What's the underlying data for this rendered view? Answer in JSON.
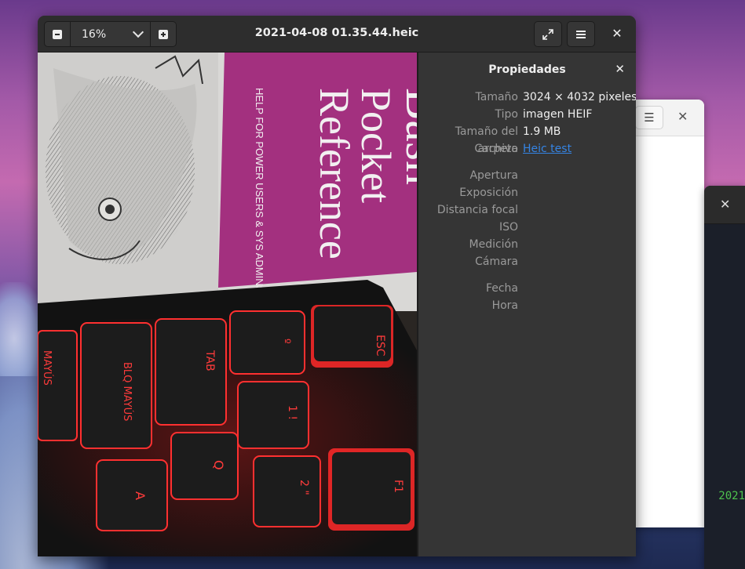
{
  "window": {
    "title": "2021-04-08 01.35.44.heic",
    "zoom": "16%"
  },
  "icons": {
    "zoom_out": "minus-square-icon",
    "zoom_in": "plus-square-icon",
    "zoom_dropdown": "chevron-down-icon",
    "fullscreen": "fullscreen-icon",
    "menu": "hamburger-menu-icon",
    "close": "close-icon"
  },
  "properties": {
    "title": "Propiedades",
    "rows": [
      {
        "key": "Tamaño",
        "value": "3024 × 4032 pixeles"
      },
      {
        "key": "Tipo",
        "value": "imagen HEIF"
      },
      {
        "key": "Tamaño del archivo",
        "value": "1.9 MB"
      },
      {
        "key": "Carpeta",
        "value": "Heic test"
      }
    ],
    "exif": [
      "Apertura",
      "Exposición",
      "Distancia focal",
      "ISO",
      "Medición",
      "Cámara"
    ],
    "datetime": [
      "Fecha",
      "Hora"
    ]
  },
  "photo": {
    "book_title_1": "Bash",
    "book_title_2": "Pocket",
    "book_title_3": "Reference",
    "book_subtitle": "HELP FOR POWER USERS & SYS ADMINS",
    "keys": [
      "ESC",
      "TAB",
      "BLQ MAYÚS",
      "MAYÚS",
      "F1",
      "Q",
      "A",
      "1 !",
      "2 \"",
      "º"
    ]
  },
  "background": {
    "terminal_text": "2021"
  },
  "colors": {
    "accent_link": "#3584e4",
    "book_magenta": "#a3307f",
    "key_glow": "#ff1a1a"
  }
}
